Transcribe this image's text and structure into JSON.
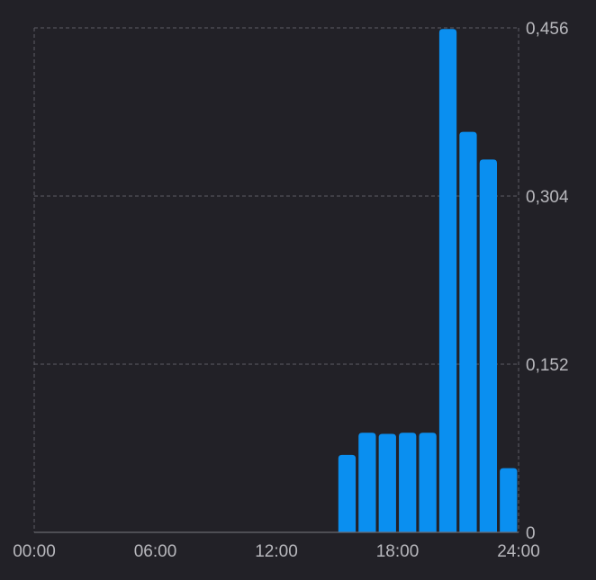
{
  "chart_data": {
    "type": "bar",
    "x": [
      15.5,
      16.5,
      17.5,
      18.5,
      19.5,
      20.5,
      21.5,
      22.5,
      23.5
    ],
    "values": [
      0.07,
      0.09,
      0.089,
      0.09,
      0.09,
      0.455,
      0.362,
      0.337,
      0.058
    ],
    "bar_color": "#0a8ff0",
    "xlim": [
      0,
      24
    ],
    "ylim": [
      0,
      0.456
    ],
    "x_ticks": [
      "00:00",
      "06:00",
      "12:00",
      "18:00",
      "24:00"
    ],
    "x_tick_values": [
      0,
      6,
      12,
      18,
      24
    ],
    "y_ticks": [
      "0",
      "0,152",
      "0,304",
      "0,456"
    ],
    "y_tick_values": [
      0,
      0.152,
      0.304,
      0.456
    ],
    "grid": true,
    "y_axis_position": "right"
  }
}
